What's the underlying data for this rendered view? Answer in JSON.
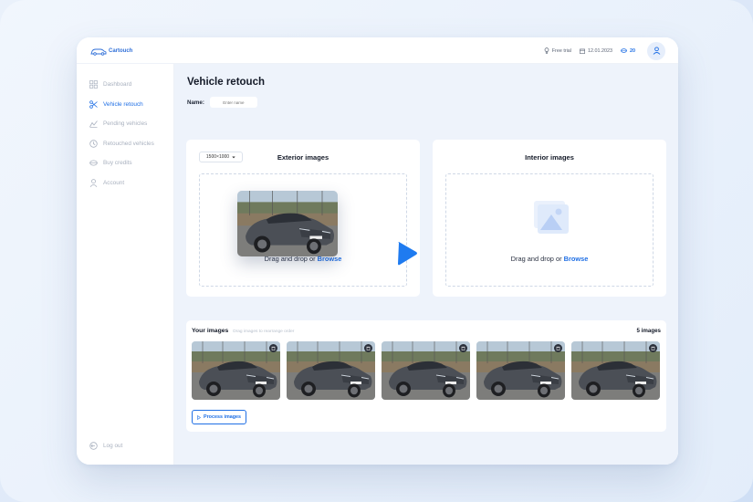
{
  "app": {
    "logo_text": "Cartouch"
  },
  "topbar": {
    "trial_label": "Free trial",
    "date": "12.01.2023",
    "credits": "20"
  },
  "sidebar": {
    "items": [
      {
        "label": "Dashboard",
        "icon": "grid-icon",
        "active": false
      },
      {
        "label": "Vehicle retouch",
        "icon": "scissors-icon",
        "active": true
      },
      {
        "label": "Pending vehicles",
        "icon": "chart-icon",
        "active": false
      },
      {
        "label": "Retouched vehicles",
        "icon": "history-icon",
        "active": false
      },
      {
        "label": "Buy credits",
        "icon": "coins-icon",
        "active": false
      },
      {
        "label": "Account",
        "icon": "user-icon",
        "active": false
      }
    ],
    "logout_label": "Log out"
  },
  "main": {
    "title": "Vehicle retouch",
    "name_label": "Name:",
    "name_placeholder": "Enter name",
    "exterior": {
      "title": "Exterior images",
      "resolution": "1500×1000",
      "drop_text": "Drag and drop or",
      "browse": "Browse"
    },
    "interior": {
      "title": "Interior images",
      "drop_text": "Drag and drop or",
      "browse": "Browse"
    },
    "your_images": {
      "title": "Your images",
      "hint": "Drag images to rearrange order",
      "count": "5 images",
      "process_label": "Process images"
    }
  },
  "colors": {
    "accent": "#1f6fe5",
    "background": "#eef3fb"
  }
}
